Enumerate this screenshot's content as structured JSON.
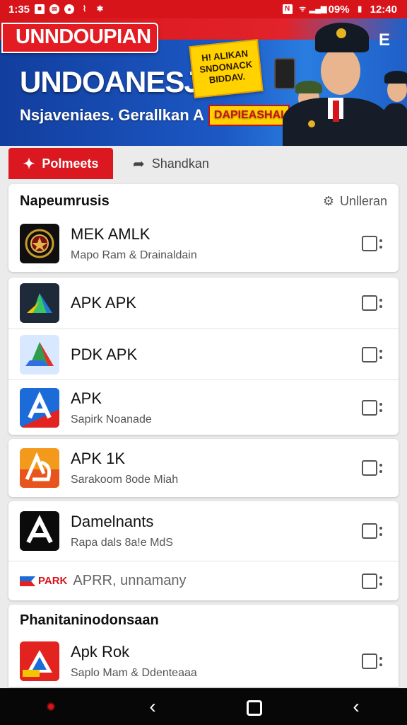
{
  "status_bar": {
    "time": "1:35",
    "battery": "09%",
    "clock": "12:40"
  },
  "banner": {
    "tag": "UNNDOUPIAN",
    "title": "UNDOANESJA",
    "subtitle": "Nsjaveniaes. Gerallkan A",
    "subtitle_tag": "DAPIEASHAI",
    "sticker": "H! ALIKAN SNDONACK BIDDAV.",
    "menu_icon": "E"
  },
  "tabs": [
    {
      "label": "Polmeets",
      "icon": "apps-icon",
      "active": true
    },
    {
      "label": "Shandkan",
      "icon": "share-icon",
      "active": false
    }
  ],
  "sections": [
    {
      "title": "Napeumrusis",
      "action": "Unlleran",
      "items": [
        {
          "title": "MEK AMLK",
          "subtitle": "Mapo Ram & Drainaldain",
          "icon": "emblem-icon",
          "icon_bg": "#0f0f0f"
        }
      ]
    },
    {
      "items": [
        {
          "title": "APK APK",
          "subtitle": "",
          "icon": "drive-icon",
          "icon_bg": "#ffffff"
        },
        {
          "title": "PDK APK",
          "subtitle": "",
          "icon": "drive-alt-icon",
          "icon_bg": "#d8e8ff"
        },
        {
          "title": "APK",
          "subtitle": "Sapirk Noanade",
          "icon": "arrow-a-icon",
          "icon_bg": "#1b6bd8"
        }
      ]
    },
    {
      "items": [
        {
          "title": "APK 1K",
          "subtitle": "Sarakoom 8ode Miah",
          "icon": "orange-a-icon",
          "icon_bg": "#f39a1c"
        }
      ]
    },
    {
      "items": [
        {
          "title": "Damelnants",
          "subtitle": "Rapa dals 8a!e MdS",
          "icon": "black-a-icon",
          "icon_bg": "#0b0b0b"
        },
        {
          "title": "APRR, unnamany",
          "subtitle": "",
          "icon": "park-flag-icon",
          "icon_bg": "#ffffff",
          "prefix": "PARK"
        }
      ]
    },
    {
      "title": "Phanitaninodonsaan",
      "items": [
        {
          "title": "Apk Rok",
          "subtitle": "Saplo Mam & Ddenteaaa",
          "icon": "red-flag-a-icon",
          "icon_bg": "#e3231f"
        }
      ]
    }
  ],
  "colors": {
    "brand_red": "#d8141b",
    "banner_blue": "#1c58c4",
    "sticker_yellow": "#ffd200"
  }
}
